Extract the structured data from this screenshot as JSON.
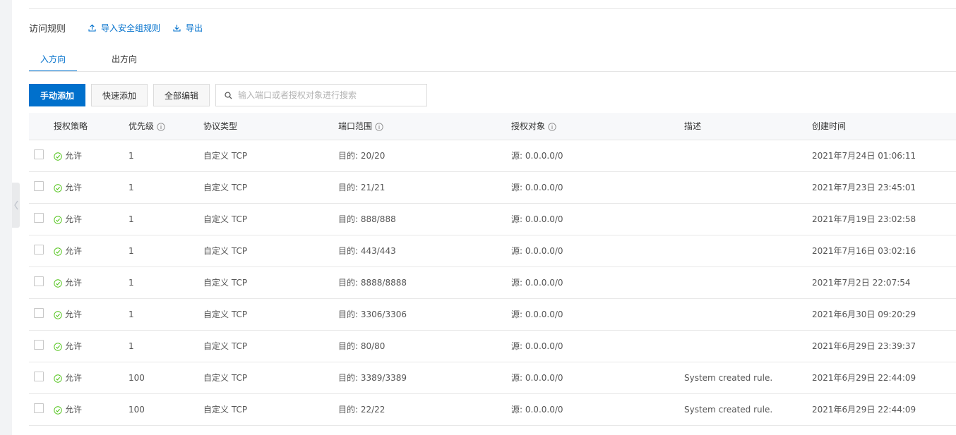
{
  "header": {
    "title": "访问规则",
    "import_label": "导入安全组规则",
    "export_label": "导出"
  },
  "tabs": [
    {
      "label": "入方向",
      "active": true
    },
    {
      "label": "出方向",
      "active": false
    }
  ],
  "toolbar": {
    "manual_add_label": "手动添加",
    "quick_add_label": "快速添加",
    "edit_all_label": "全部编辑",
    "search_placeholder": "输入端口或者授权对象进行搜索"
  },
  "table": {
    "columns": {
      "policy": "授权策略",
      "priority": "优先级",
      "protocol": "协议类型",
      "port_range": "端口范围",
      "auth_object": "授权对象",
      "description": "描述",
      "created_time": "创建时间"
    },
    "rows": [
      {
        "policy": "允许",
        "priority": "1",
        "protocol": "自定义 TCP",
        "port_range": "目的: 20/20",
        "auth_object": "源: 0.0.0.0/0",
        "description": "",
        "created_time": "2021年7月24日 01:06:11"
      },
      {
        "policy": "允许",
        "priority": "1",
        "protocol": "自定义 TCP",
        "port_range": "目的: 21/21",
        "auth_object": "源: 0.0.0.0/0",
        "description": "",
        "created_time": "2021年7月23日 23:45:01"
      },
      {
        "policy": "允许",
        "priority": "1",
        "protocol": "自定义 TCP",
        "port_range": "目的: 888/888",
        "auth_object": "源: 0.0.0.0/0",
        "description": "",
        "created_time": "2021年7月19日 23:02:58"
      },
      {
        "policy": "允许",
        "priority": "1",
        "protocol": "自定义 TCP",
        "port_range": "目的: 443/443",
        "auth_object": "源: 0.0.0.0/0",
        "description": "",
        "created_time": "2021年7月16日 03:02:16"
      },
      {
        "policy": "允许",
        "priority": "1",
        "protocol": "自定义 TCP",
        "port_range": "目的: 8888/8888",
        "auth_object": "源: 0.0.0.0/0",
        "description": "",
        "created_time": "2021年7月2日 22:07:54"
      },
      {
        "policy": "允许",
        "priority": "1",
        "protocol": "自定义 TCP",
        "port_range": "目的: 3306/3306",
        "auth_object": "源: 0.0.0.0/0",
        "description": "",
        "created_time": "2021年6月30日 09:20:29"
      },
      {
        "policy": "允许",
        "priority": "1",
        "protocol": "自定义 TCP",
        "port_range": "目的: 80/80",
        "auth_object": "源: 0.0.0.0/0",
        "description": "",
        "created_time": "2021年6月29日 23:39:37"
      },
      {
        "policy": "允许",
        "priority": "100",
        "protocol": "自定义 TCP",
        "port_range": "目的: 3389/3389",
        "auth_object": "源: 0.0.0.0/0",
        "description": "System created rule.",
        "created_time": "2021年6月29日 22:44:09"
      },
      {
        "policy": "允许",
        "priority": "100",
        "protocol": "自定义 TCP",
        "port_range": "目的: 22/22",
        "auth_object": "源: 0.0.0.0/0",
        "description": "System created rule.",
        "created_time": "2021年6月29日 22:44:09"
      }
    ]
  },
  "colors": {
    "accent": "#0070cc",
    "allow_green": "#52c41a"
  }
}
